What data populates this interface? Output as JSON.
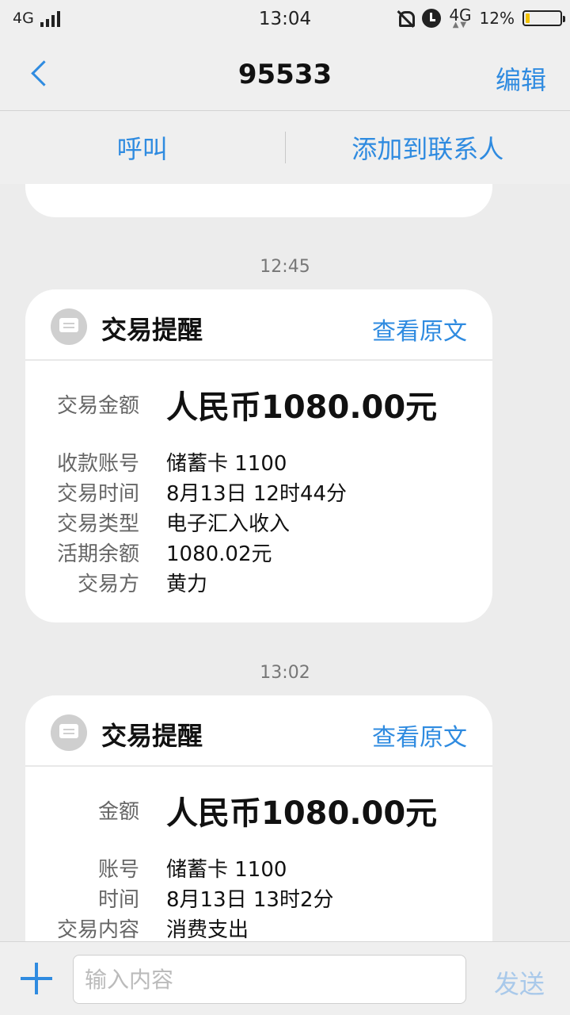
{
  "status_bar": {
    "network": "4G",
    "time": "13:04",
    "network_right": "4G",
    "battery_text": "12%",
    "battery_level": 0.12,
    "battery_color": "#f2c200"
  },
  "nav": {
    "title": "95533",
    "edit_label": "编辑"
  },
  "actions": {
    "call_label": "呼叫",
    "add_contact_label": "添加到联系人"
  },
  "messages": [
    {
      "time": "12:45",
      "title": "交易提醒",
      "view_original": "查看原文",
      "amount_label": "交易金额",
      "amount": "人民币1080.00元",
      "rows": [
        {
          "k": "收款账号",
          "v": "储蓄卡 1100"
        },
        {
          "k": "交易时间",
          "v": "8月13日 12时44分"
        },
        {
          "k": "交易类型",
          "v": "电子汇入收入"
        },
        {
          "k": "活期余额",
          "v": "1080.02元"
        },
        {
          "k": "交易方",
          "v": "黄力"
        }
      ]
    },
    {
      "time": "13:02",
      "title": "交易提醒",
      "view_original": "查看原文",
      "amount_label": "金额",
      "amount": "人民币1080.00元",
      "rows": [
        {
          "k": "账号",
          "v": "储蓄卡 1100"
        },
        {
          "k": "时间",
          "v": "8月13日 13时2分"
        },
        {
          "k": "交易内容",
          "v": "消费支出"
        }
      ]
    }
  ],
  "input": {
    "placeholder": "输入内容",
    "send_label": "发送"
  },
  "colors": {
    "accent": "#2f8be0",
    "send_disabled": "#a9c9ea"
  }
}
